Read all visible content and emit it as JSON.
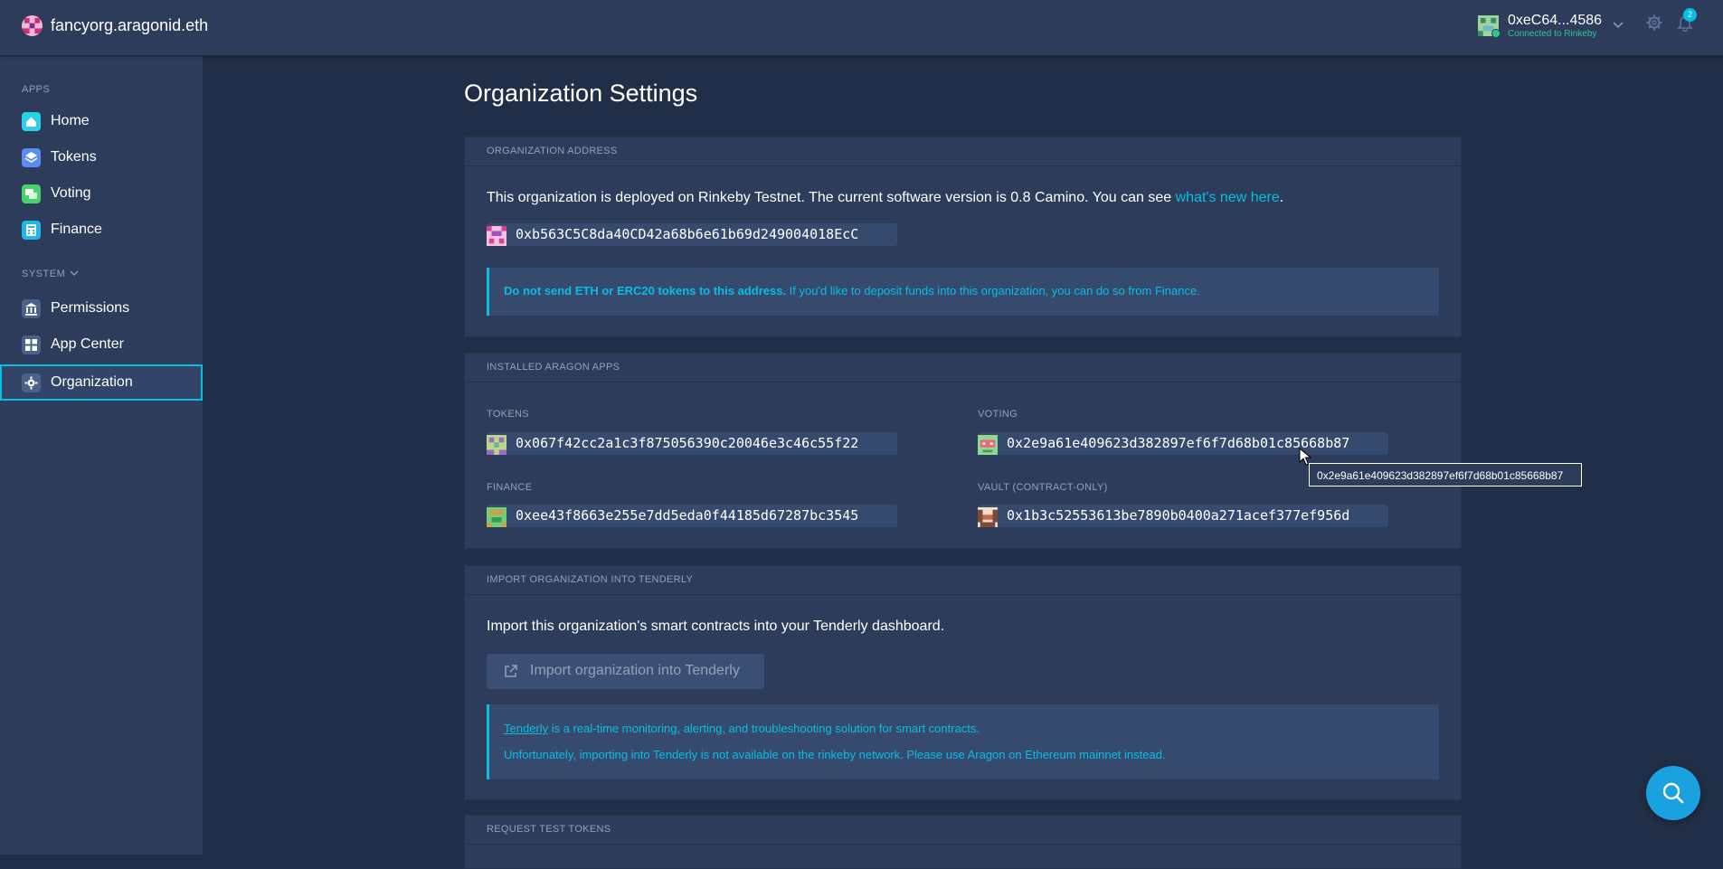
{
  "header": {
    "org_name": "fancyorg.aragonid.eth",
    "account_address": "0xeC64...4586",
    "account_status": "Connected to Rinkeby",
    "notifications_count": "2"
  },
  "sidebar": {
    "apps_label": "APPS",
    "system_label": "SYSTEM",
    "apps": [
      {
        "label": "Home",
        "icon": "home-icon"
      },
      {
        "label": "Tokens",
        "icon": "tokens-icon"
      },
      {
        "label": "Voting",
        "icon": "voting-icon"
      },
      {
        "label": "Finance",
        "icon": "finance-icon"
      }
    ],
    "system": [
      {
        "label": "Permissions",
        "icon": "permissions-icon"
      },
      {
        "label": "App Center",
        "icon": "app-center-icon"
      },
      {
        "label": "Organization",
        "icon": "gear-icon",
        "active": true
      }
    ]
  },
  "main": {
    "title": "Organization Settings",
    "org_address_panel": {
      "header": "ORGANIZATION ADDRESS",
      "text_before": "This organization is deployed on Rinkeby Testnet. The current software version is 0.8 Camino. You can see ",
      "link": "what's new here",
      "text_after": ".",
      "address": "0xb563C5C8da40CD42a68b6e61b69d249004018EcC",
      "warning_bold": "Do not send ETH or ERC20 tokens to this address.",
      "warning_rest": " If you'd like to deposit funds into this organization, you can do so from Finance."
    },
    "installed_apps_panel": {
      "header": "INSTALLED ARAGON APPS",
      "apps": [
        {
          "label": "TOKENS",
          "address": "0x067f42cc2a1c3f875056390c20046e3c46c55f22"
        },
        {
          "label": "VOTING",
          "address": "0x2e9a61e409623d382897ef6f7d68b01c85668b87"
        },
        {
          "label": "FINANCE",
          "address": "0xee43f8663e255e7dd5eda0f44185d67287bc3545"
        },
        {
          "label": "VAULT (CONTRACT-ONLY)",
          "address": "0x1b3c52553613be7890b0400a271acef377ef956d"
        }
      ]
    },
    "tenderly_panel": {
      "header": "IMPORT ORGANIZATION INTO TENDERLY",
      "description": "Import this organization's smart contracts into your Tenderly dashboard.",
      "button_label": "Import organization into Tenderly",
      "info_link": "Tenderly",
      "info_line1_rest": " is a real-time monitoring, alerting, and troubleshooting solution for smart contracts.",
      "info_line2": "Unfortunately, importing into Tenderly is not available on the rinkeby network. Please use Aragon on Ethereum mainnet instead."
    },
    "test_tokens_panel": {
      "header": "REQUEST TEST TOKENS"
    }
  },
  "tooltip": {
    "text": "0x2e9a61e409623d382897ef6f7d68b01c85668b87"
  },
  "colors": {
    "accent": "#08bee5",
    "background": "#212e47",
    "surface": "#2c3c5a",
    "connected": "#2cc68f"
  }
}
